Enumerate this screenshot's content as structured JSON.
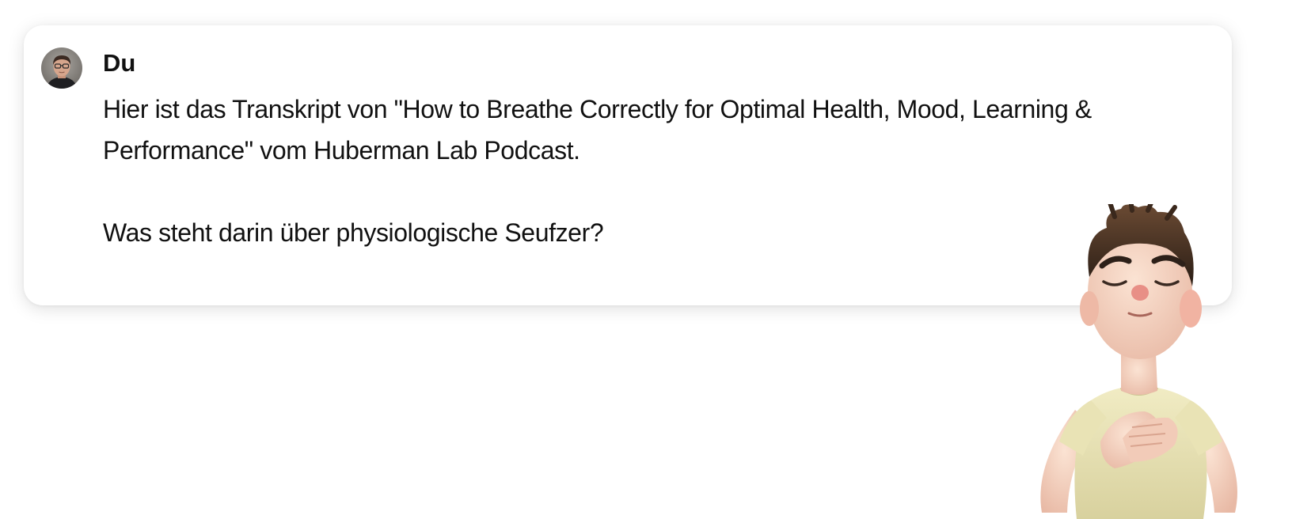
{
  "message": {
    "author": "Du",
    "paragraph1": "Hier ist das Transkript von \"How to Breathe Correctly for Optimal Health, Mood, Learning & Performance\" vom Huberman Lab Podcast.",
    "paragraph2": "Was steht darin über physiologische Seufzer?"
  },
  "icons": {
    "avatar": "user-avatar-photo",
    "character": "cartoon-boy-breathing-illustration"
  }
}
